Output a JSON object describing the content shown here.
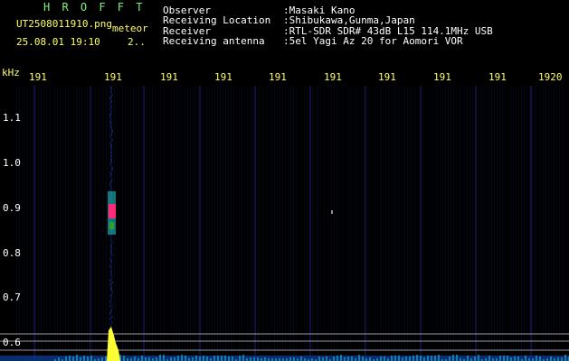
{
  "title": "H R O F F T",
  "filename": "UT2508011910.png",
  "meteor_label": "meteor",
  "datetime": "25.08.01 19:10",
  "count": "2..",
  "info": [
    {
      "label": "Observer",
      "value": ":Masaki Kano"
    },
    {
      "label": "Receiving Location",
      "value": ":Shibukawa,Gunma,Japan"
    },
    {
      "label": "Receiver",
      "value": ":RTL-SDR SDR# 43dB L15 114.1MHz USB"
    },
    {
      "label": "Receiving antenna",
      "value": ":5el Yagi Az 20 for Aomori VOR"
    }
  ],
  "axis": {
    "unit": "kHz",
    "y_ticks": [
      "1.1",
      "1.0",
      "0.9",
      "0.8",
      "0.7",
      "0.6"
    ],
    "x_ticks": [
      "191",
      "191",
      "191",
      "191",
      "191",
      "191",
      "191",
      "191",
      "191",
      "1920"
    ]
  },
  "colors": {
    "title": "#7ff07f",
    "header_text": "#ffff66",
    "info_text": "#ffffff",
    "echo_core": "#ff2a7a",
    "echo_edge": "#20c0c0",
    "baseline": "#ffff33"
  }
}
